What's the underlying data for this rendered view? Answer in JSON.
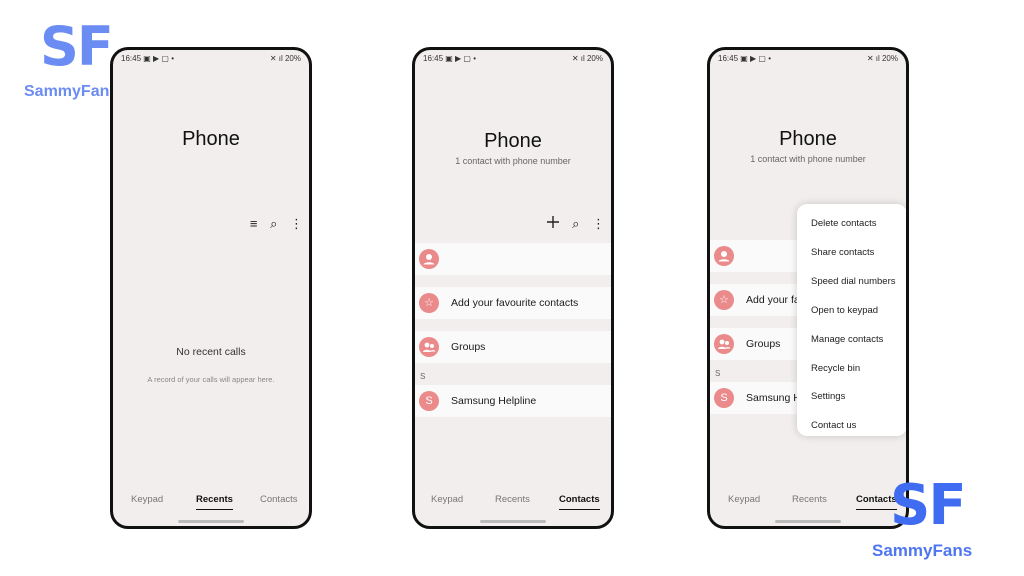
{
  "watermark": {
    "mark": "SF",
    "word": "SammyFans",
    "color": "#6b8cf2"
  },
  "status": {
    "time": "16:45",
    "left_icons": "▣ ▶ ▢ •",
    "right_icons": "✕ ıl",
    "battery": "20%"
  },
  "phone_recents": {
    "title": "Phone",
    "toolbar": {
      "filter_icon": "≡",
      "search_icon": "⌕",
      "more_icon": "⋮"
    },
    "empty_title": "No recent calls",
    "empty_subtitle": "A record of your calls will appear here.",
    "nav": {
      "keypad": "Keypad",
      "recents": "Recents",
      "contacts": "Contacts",
      "active": "recents"
    }
  },
  "phone_contacts": {
    "title": "Phone",
    "subtitle": "1 contact with phone number",
    "rows": {
      "favourites": "Add your favourite contacts",
      "groups": "Groups",
      "section_letter": "S",
      "contact_name": "Samsung Helpline",
      "contact_initial": "S"
    },
    "nav": {
      "keypad": "Keypad",
      "recents": "Recents",
      "contacts": "Contacts",
      "active": "contacts"
    }
  },
  "phone_menu": {
    "title": "Phone",
    "subtitle": "1 contact with phone number",
    "rows": {
      "favourites_truncated": "Add your fa",
      "groups": "Groups",
      "section_letter": "S",
      "contact_truncated": "Samsung H",
      "contact_initial": "S"
    },
    "menu": [
      "Delete contacts",
      "Share contacts",
      "Speed dial numbers",
      "Open to keypad",
      "Manage contacts",
      "Recycle bin",
      "Settings",
      "Contact us"
    ],
    "nav": {
      "keypad": "Keypad",
      "recents": "Recents",
      "contacts": "Contacts",
      "active": "contacts"
    }
  },
  "colors": {
    "avatar": "#ea8a8a",
    "screen_bg": "#f2eeed",
    "frame": "#111111"
  }
}
